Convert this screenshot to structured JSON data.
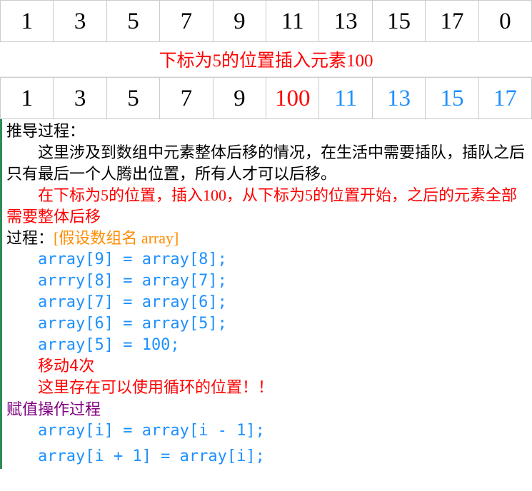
{
  "arrays": {
    "before": [
      {
        "v": "1"
      },
      {
        "v": "3"
      },
      {
        "v": "5"
      },
      {
        "v": "7"
      },
      {
        "v": "9"
      },
      {
        "v": "11"
      },
      {
        "v": "13"
      },
      {
        "v": "15"
      },
      {
        "v": "17"
      },
      {
        "v": "0"
      }
    ],
    "after": [
      {
        "v": "1",
        "c": ""
      },
      {
        "v": "3",
        "c": ""
      },
      {
        "v": "5",
        "c": ""
      },
      {
        "v": "7",
        "c": ""
      },
      {
        "v": "9",
        "c": ""
      },
      {
        "v": "100",
        "c": "clr-red"
      },
      {
        "v": "11",
        "c": "clr-blue"
      },
      {
        "v": "13",
        "c": "clr-blue"
      },
      {
        "v": "15",
        "c": "clr-blue"
      },
      {
        "v": "17",
        "c": "clr-blue"
      }
    ]
  },
  "caption": "下标为5的位置插入元素100",
  "body": {
    "p1": "推导过程：",
    "p2": "这里涉及到数组中元素整体后移的情况，在生活中需要插队，插队之后只有最后一个人腾出位置，所有人才可以后移。",
    "p3": "在下标为5的位置，插入100，从下标为5的位置开始，之后的元素全部需要整体后移",
    "p4_a": "过程：",
    "p4_b": "[假设数组名 array]",
    "code": {
      "l1": "array[9] = array[8];",
      "l2": "arrry[8] = array[7];",
      "l3": "array[7] = array[6];",
      "l4": "array[6] = array[5];",
      "l5": "array[5] = 100;",
      "l6": "移动4次",
      "l7": "这里存在可以使用循环的位置！！"
    },
    "p5": "赋值操作过程",
    "code2": {
      "l1": "array[i] = array[i - 1];",
      "l2": "array[i + 1] = array[i];"
    }
  }
}
